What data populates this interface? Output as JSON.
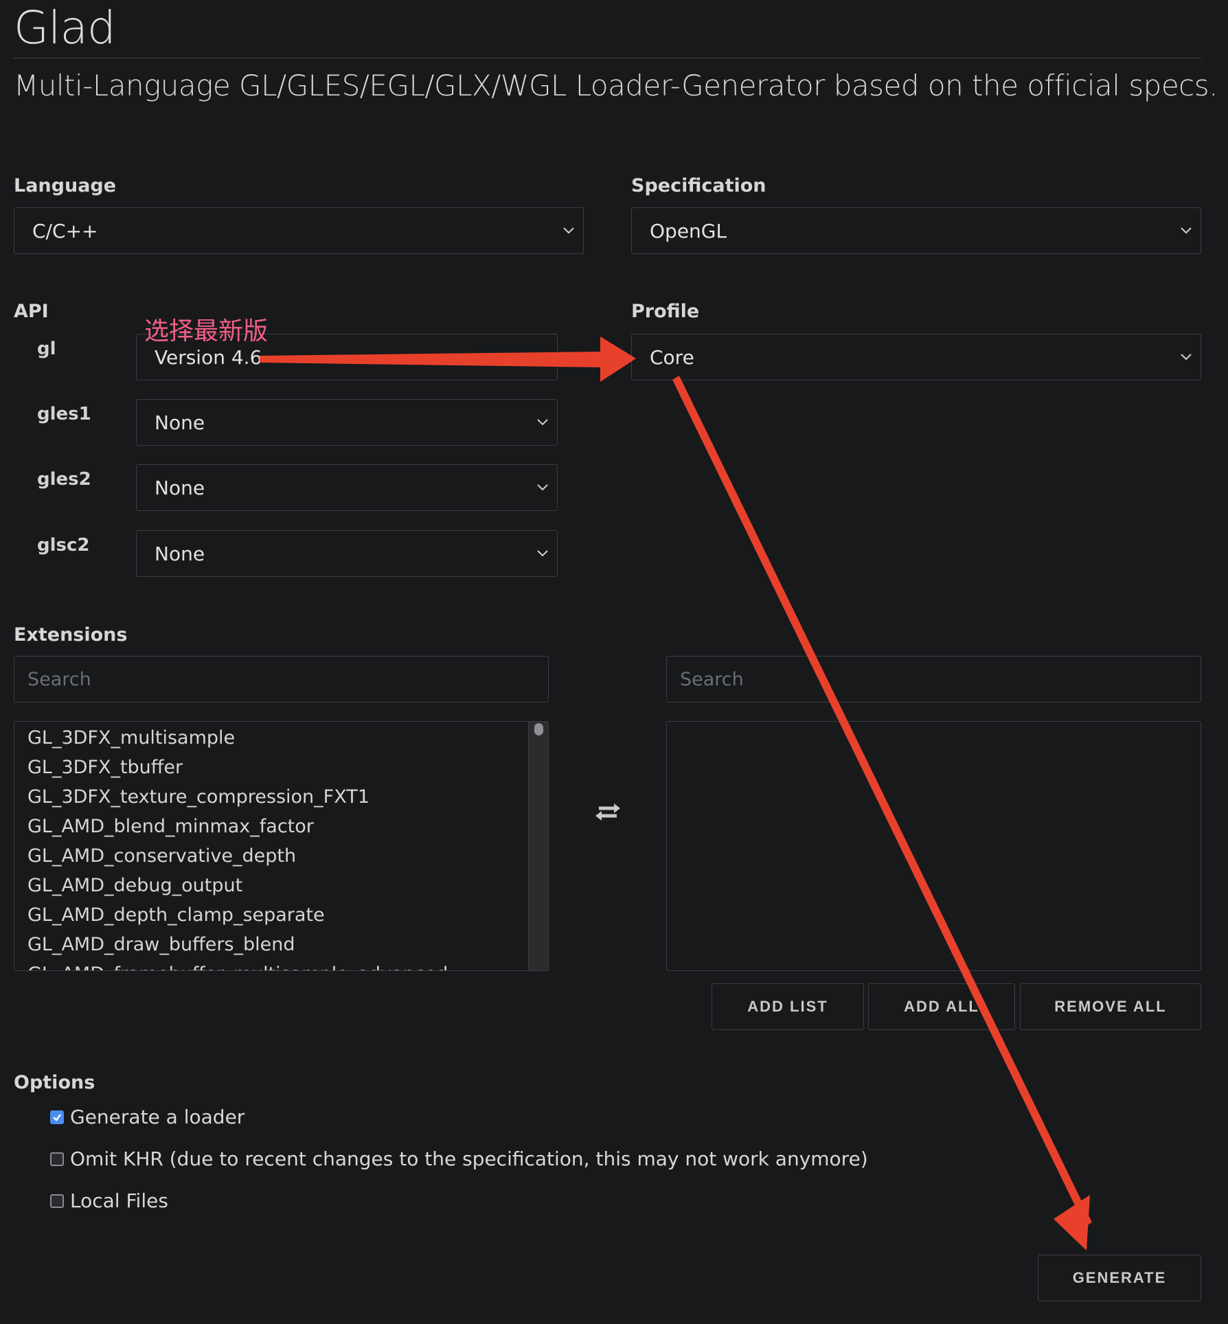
{
  "header": {
    "title": "Glad",
    "subtitle": "Multi-Language GL/GLES/EGL/GLX/WGL Loader-Generator based on the official specs."
  },
  "language": {
    "label": "Language",
    "value": "C/C++"
  },
  "specification": {
    "label": "Specification",
    "value": "OpenGL"
  },
  "api": {
    "label": "API",
    "rows": [
      {
        "name": "gl",
        "value": "Version 4.6"
      },
      {
        "name": "gles1",
        "value": "None"
      },
      {
        "name": "gles2",
        "value": "None"
      },
      {
        "name": "glsc2",
        "value": "None"
      }
    ]
  },
  "profile": {
    "label": "Profile",
    "value": "Core"
  },
  "annotation": {
    "text": "选择最新版",
    "color": "#ef5f86",
    "arrow_color": "#e8412b"
  },
  "extensions": {
    "label": "Extensions",
    "left_search_placeholder": "Search",
    "right_search_placeholder": "Search",
    "available": [
      "GL_3DFX_multisample",
      "GL_3DFX_tbuffer",
      "GL_3DFX_texture_compression_FXT1",
      "GL_AMD_blend_minmax_factor",
      "GL_AMD_conservative_depth",
      "GL_AMD_debug_output",
      "GL_AMD_depth_clamp_separate",
      "GL_AMD_draw_buffers_blend",
      "GL_AMD_framebuffer_multisample_advanced"
    ],
    "swap_icon": "swap-arrows-icon",
    "buttons": {
      "add_list": "ADD LIST",
      "add_all": "ADD ALL",
      "remove_all": "REMOVE ALL"
    }
  },
  "options": {
    "label": "Options",
    "items": [
      {
        "text": "Generate a loader",
        "checked": true
      },
      {
        "text": "Omit KHR (due to recent changes to the specification, this may not work anymore)",
        "checked": false
      },
      {
        "text": "Local Files",
        "checked": false
      }
    ]
  },
  "generate": {
    "label": "GENERATE"
  },
  "colors": {
    "background": "#18191b",
    "border": "#3b3d40",
    "checkbox_accent": "#4a8df0"
  }
}
